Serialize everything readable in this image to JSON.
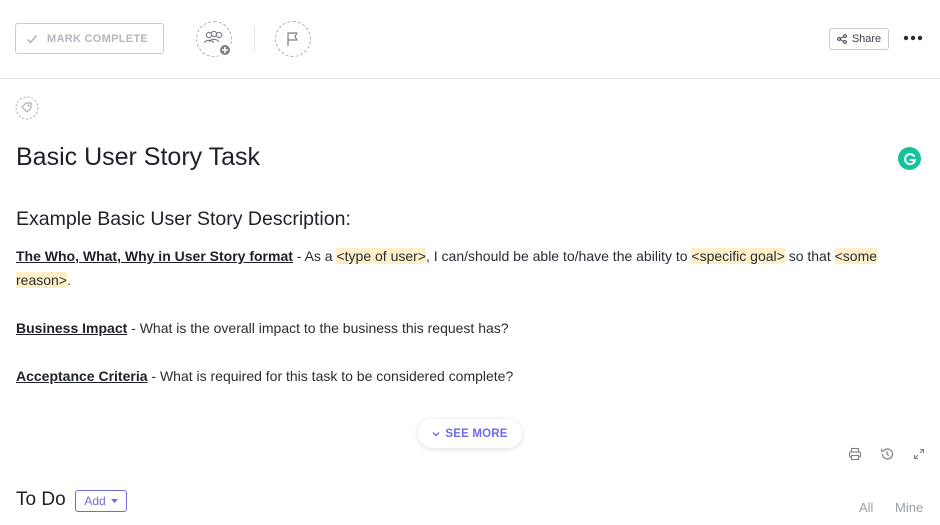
{
  "toolbar": {
    "mark_complete_label": "MARK COMPLETE",
    "share_label": "Share"
  },
  "task": {
    "title": "Basic User Story Task"
  },
  "description": {
    "heading": "Example Basic User Story Description:",
    "paragraph1": {
      "link": "The Who, What, Why in User Story format",
      "t1": " - As a ",
      "h1": "<type of user>",
      "t2": ", I can/should be able to/have the ability to ",
      "h2": "<specific goal>",
      "t3": " so that ",
      "h3": "<some reason>",
      "t4": "."
    },
    "paragraph2": {
      "link": "Business Impact",
      "text": " - What is the overall impact to the business this request has?"
    },
    "paragraph3": {
      "link": "Acceptance Criteria",
      "text": " - What is required for this task to be considered complete?"
    },
    "see_more_label": "SEE MORE"
  },
  "todo": {
    "label": "To Do",
    "add_label": "Add",
    "filters": [
      "All",
      "Mine"
    ]
  },
  "colors": {
    "accent": "#6d6ce0",
    "highlight": "#fdf0c8",
    "grammarly": "#15c39a"
  }
}
